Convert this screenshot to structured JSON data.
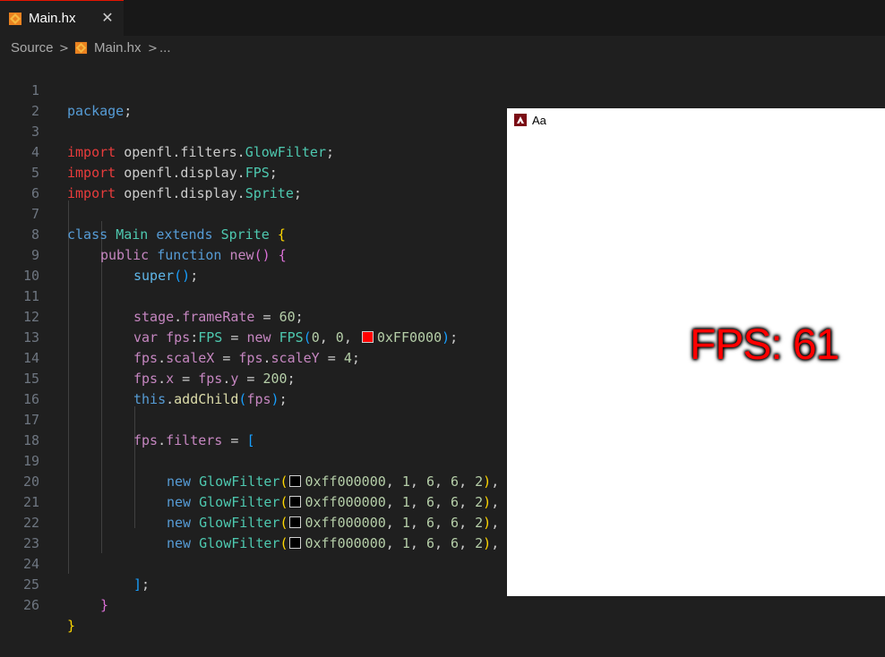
{
  "tab": {
    "filename": "Main.hx",
    "close_glyph": "✕"
  },
  "breadcrumb": {
    "root": "Source",
    "sep": ">",
    "file": "Main.hx",
    "more": "..."
  },
  "swatch_colors": {
    "red": "#ff0000",
    "black": "#000000"
  },
  "code_lines": [
    {
      "n": "1"
    },
    {
      "n": "2"
    },
    {
      "n": "3"
    },
    {
      "n": "4"
    },
    {
      "n": "5"
    },
    {
      "n": "6"
    },
    {
      "n": "7"
    },
    {
      "n": "8"
    },
    {
      "n": "9"
    },
    {
      "n": "10"
    },
    {
      "n": "11"
    },
    {
      "n": "12"
    },
    {
      "n": "13"
    },
    {
      "n": "14"
    },
    {
      "n": "15"
    },
    {
      "n": "16"
    },
    {
      "n": "17"
    },
    {
      "n": "18"
    },
    {
      "n": "19"
    },
    {
      "n": "20"
    },
    {
      "n": "21"
    },
    {
      "n": "22"
    },
    {
      "n": "23"
    },
    {
      "n": "24"
    },
    {
      "n": "25"
    },
    {
      "n": "26"
    }
  ],
  "code": {
    "l1": [
      "package",
      ";"
    ],
    "l3": [
      "import",
      " openfl.filters.",
      "GlowFilter",
      ";"
    ],
    "l4": [
      "import",
      " openfl.display.",
      "FPS",
      ";"
    ],
    "l5": [
      "import",
      " openfl.display.",
      "Sprite",
      ";"
    ],
    "l7": [
      "class",
      " ",
      "Main",
      " ",
      "extends",
      " ",
      "Sprite",
      " ",
      "{"
    ],
    "l8": [
      "public",
      " ",
      "function",
      " ",
      "new",
      "()",
      " ",
      "{"
    ],
    "l9": [
      "super",
      "()",
      ";"
    ],
    "l11": [
      "stage",
      ".",
      "frameRate",
      " = ",
      "60",
      ";"
    ],
    "l12": [
      "var",
      " ",
      "fps",
      ":",
      "FPS",
      " = ",
      "new",
      " ",
      "FPS",
      "(",
      "0",
      ", ",
      "0",
      ", ",
      "0xFF0000",
      ")",
      ";"
    ],
    "l13": [
      "fps",
      ".",
      "scaleX",
      " = ",
      "fps",
      ".",
      "scaleY",
      " = ",
      "4",
      ";"
    ],
    "l14": [
      "fps",
      ".",
      "x",
      " = ",
      "fps",
      ".",
      "y",
      " = ",
      "200",
      ";"
    ],
    "l15": [
      "this",
      ".",
      "addChild",
      "(",
      "fps",
      ")",
      ";"
    ],
    "l17": [
      "fps",
      ".",
      "filters",
      " = ",
      "["
    ],
    "glow": [
      "new",
      " ",
      "GlowFilter",
      "(",
      "0xff000000",
      ", ",
      "1",
      ", ",
      "6",
      ", ",
      "6",
      ", ",
      "2",
      ")",
      ","
    ],
    "l24": [
      "]",
      ";"
    ],
    "l25": [
      "}"
    ],
    "l26": [
      "}"
    ]
  },
  "preview": {
    "title": "Aa",
    "fps_text": "FPS: 61"
  }
}
